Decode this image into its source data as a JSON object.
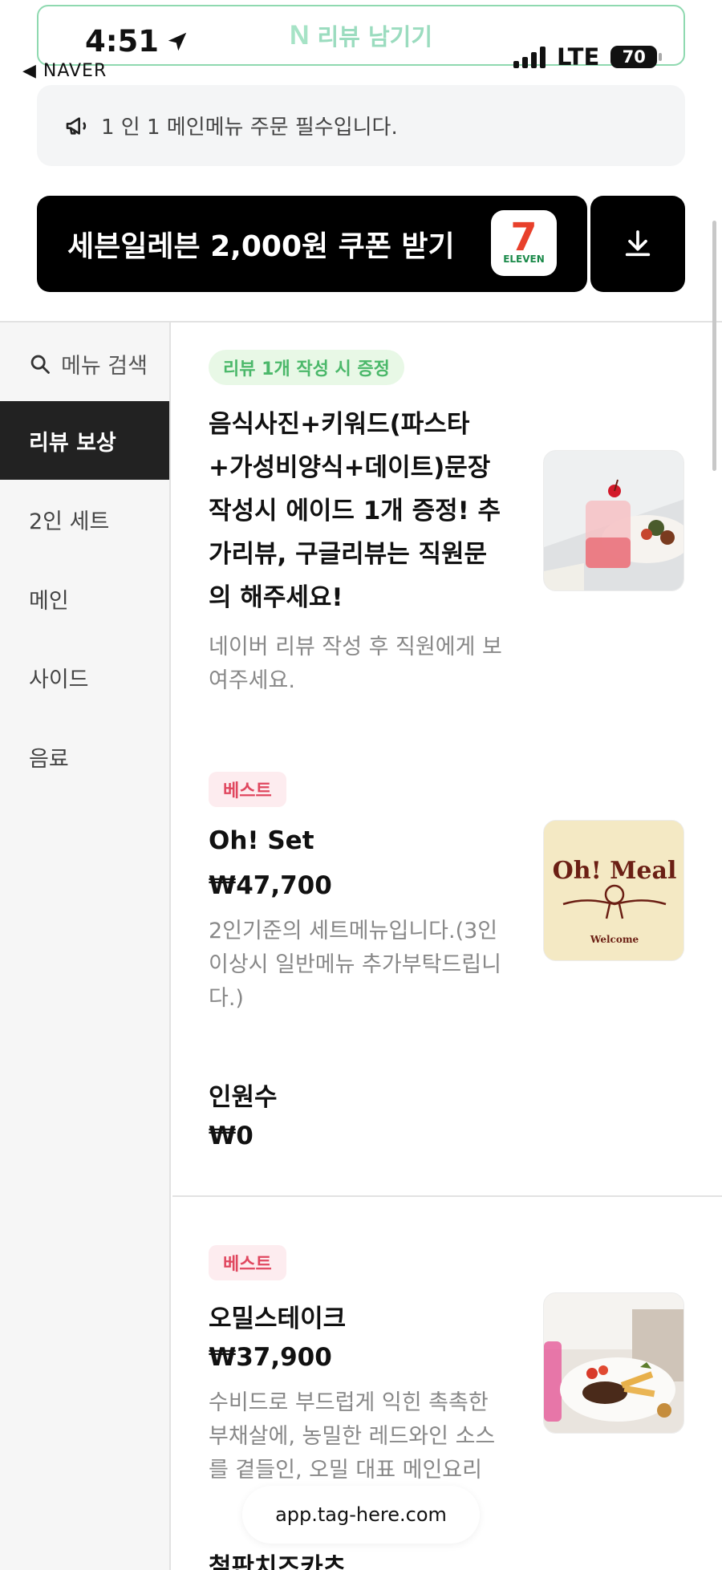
{
  "status_bar": {
    "time": "4:51",
    "back_label": "◀ NAVER",
    "network": "LTE",
    "battery": "70"
  },
  "review_button": {
    "icon": "naver-n-icon",
    "label": "리뷰 남기기"
  },
  "notice": {
    "icon": "megaphone-icon",
    "text": "1 인 1 메인메뉴 주문 필수입니다."
  },
  "coupon": {
    "label": "세븐일레븐 2,000원 쿠폰 받기",
    "logo_num": "7",
    "logo_text": "ELEVEN",
    "download_icon": "download-icon"
  },
  "sidebar": {
    "search_label": "메뉴 검색",
    "items": [
      {
        "label": "리뷰 보상",
        "active": true
      },
      {
        "label": "2인 세트",
        "active": false
      },
      {
        "label": "메인",
        "active": false
      },
      {
        "label": "사이드",
        "active": false
      },
      {
        "label": "음료",
        "active": false
      }
    ]
  },
  "menu": {
    "review_reward": {
      "badge": "리뷰 1개 작성 시 증정",
      "title": "음식사진+키워드(파스타+가성비양식+데이트)문장 작성시 에이드 1개 증정! 추가리뷰, 구글리뷰는 직원문의 해주세요!",
      "desc": "네이버 리뷰 작성 후 직원에게 보여주세요."
    },
    "oh_set": {
      "badge": "베스트",
      "name": "Oh! Set",
      "price": "₩47,700",
      "desc": "2인기준의 세트메뉴입니다.(3인이상시 일반메뉴 추가부탁드립니다.)",
      "logo_text": "Oh! Meal",
      "logo_sub": "Welcome"
    },
    "option": {
      "name": "인원수",
      "price": "₩0"
    },
    "steak": {
      "badge": "베스트",
      "name": "오밀스테이크",
      "price": "₩37,900",
      "desc": "수비드로 부드럽게 익힌 촉촉한 부채살에, 농밀한 레드와인 소스를 곁들인, 오밀 대표 메인요리"
    },
    "next_item_name": "철판치즈카츠"
  },
  "url_pill": "app.tag-here.com",
  "colors": {
    "accent_green": "#4bb86a",
    "best_pink": "#e0475f",
    "active_bg": "#222222"
  }
}
